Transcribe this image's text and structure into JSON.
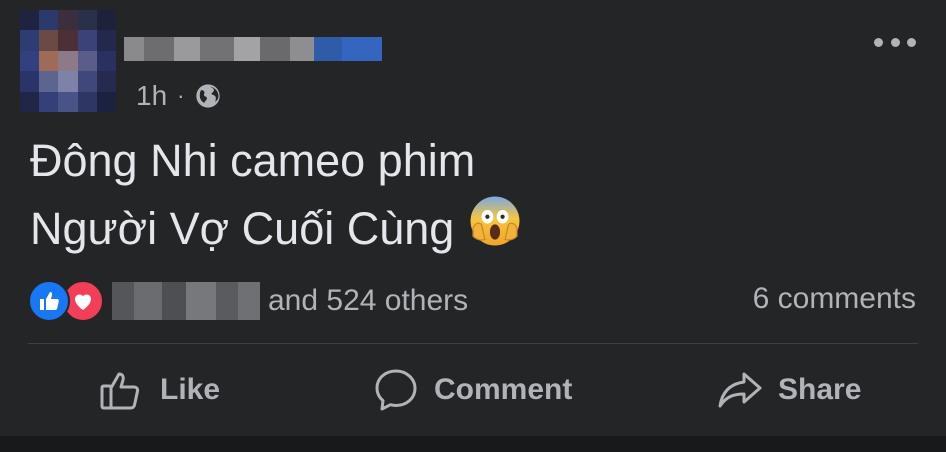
{
  "post": {
    "time": "1h",
    "separator": "·",
    "privacy_icon": "globe-icon",
    "more_icon": "more-options-icon",
    "text_line1": "Đông Nhi cameo phim",
    "text_line2": "Người Vợ Cuối Cùng",
    "emoji": "face-screaming-in-fear-emoji"
  },
  "reactions": {
    "icons": [
      "like-reaction-icon",
      "love-reaction-icon"
    ],
    "others_text": "and 524 others",
    "comments_text": "6 comments"
  },
  "actions": {
    "like_label": "Like",
    "comment_label": "Comment",
    "share_label": "Share"
  },
  "colors": {
    "background": "#242526",
    "text": "#e4e6eb",
    "secondary": "#b0b3b8",
    "like_blue": "#1877f2",
    "love_red": "#f33e58"
  }
}
